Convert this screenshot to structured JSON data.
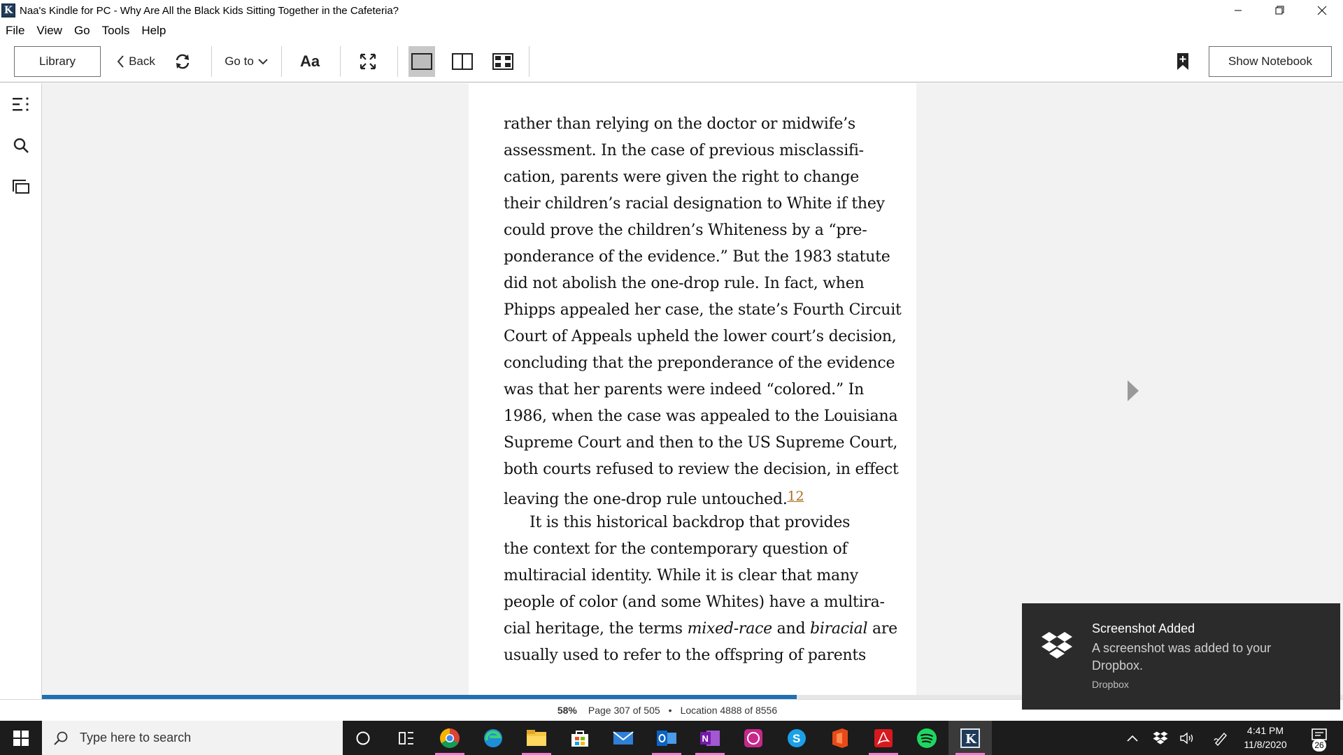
{
  "window": {
    "app_icon_letter": "K",
    "title": "Naa's Kindle for PC - Why Are All the Black Kids Sitting Together in the Cafeteria?"
  },
  "menu": [
    "File",
    "View",
    "Go",
    "Tools",
    "Help"
  ],
  "toolbar": {
    "library": "Library",
    "back": "Back",
    "goto": "Go to",
    "font": "Aa",
    "show_notebook": "Show Notebook"
  },
  "book": {
    "lines": [
      "rather than relying on the doctor or midwife’s",
      "assessment. In the case of previous misclassifi-",
      "cation, parents were given the right to change",
      "their children’s racial designation to White if they",
      "could prove the children’s Whiteness by a “pre-",
      "ponderance of the evidence.” But the 1983 statute",
      "did not abolish the one-drop rule. In fact, when",
      "Phipps appealed her case, the state’s Fourth Circuit",
      "Court of Appeals upheld the lower court’s decision,",
      "concluding that the preponderance of the evidence",
      "was that her parents were indeed “colored.” In",
      "1986, when the case was appealed to the Louisiana",
      "Supreme Court and then to the US Supreme Court,",
      "both courts refused to review the decision, in effect"
    ],
    "line15": "leaving the one-drop rule untouched.",
    "footnote": "12",
    "para2": [
      "It is this historical backdrop that provides",
      "the context for the contemporary question of",
      "multiracial identity. While it is clear that many",
      "people of color (and some Whites) have a multira-"
    ],
    "last_line_a": "cial heritage, the terms ",
    "last_line_em1": "mixed-race",
    "last_line_b": " and ",
    "last_line_em2": "biracial",
    "last_line_c": " are",
    "final_line": "usually used to refer to the offspring of parents"
  },
  "progress": {
    "fraction": 0.58,
    "percent_label": "58%",
    "page": "Page 307 of 505",
    "separator": "•",
    "location": "Location 4888 of 8556"
  },
  "toast": {
    "title": "Screenshot Added",
    "body": "A screenshot was added to your Dropbox.",
    "source": "Dropbox"
  },
  "taskbar": {
    "search_placeholder": "Type here to search",
    "time": "4:41 PM",
    "date": "11/8/2020",
    "notifications": "26",
    "apps": [
      "cortana-icon",
      "task-view-icon",
      "chrome-icon",
      "edge-icon",
      "file-explorer-icon",
      "store-icon",
      "mail-icon",
      "outlook-icon",
      "onenote-icon",
      "whatsapp-icon",
      "skype-icon",
      "office-icon",
      "acrobat-icon",
      "spotify-icon",
      "kindle-icon"
    ]
  },
  "colors": {
    "progress": "#1f6fb2",
    "footnote": "#b06a1c",
    "toast_bg": "#2b2b2b",
    "taskbar_bg": "#1c1c1c"
  }
}
